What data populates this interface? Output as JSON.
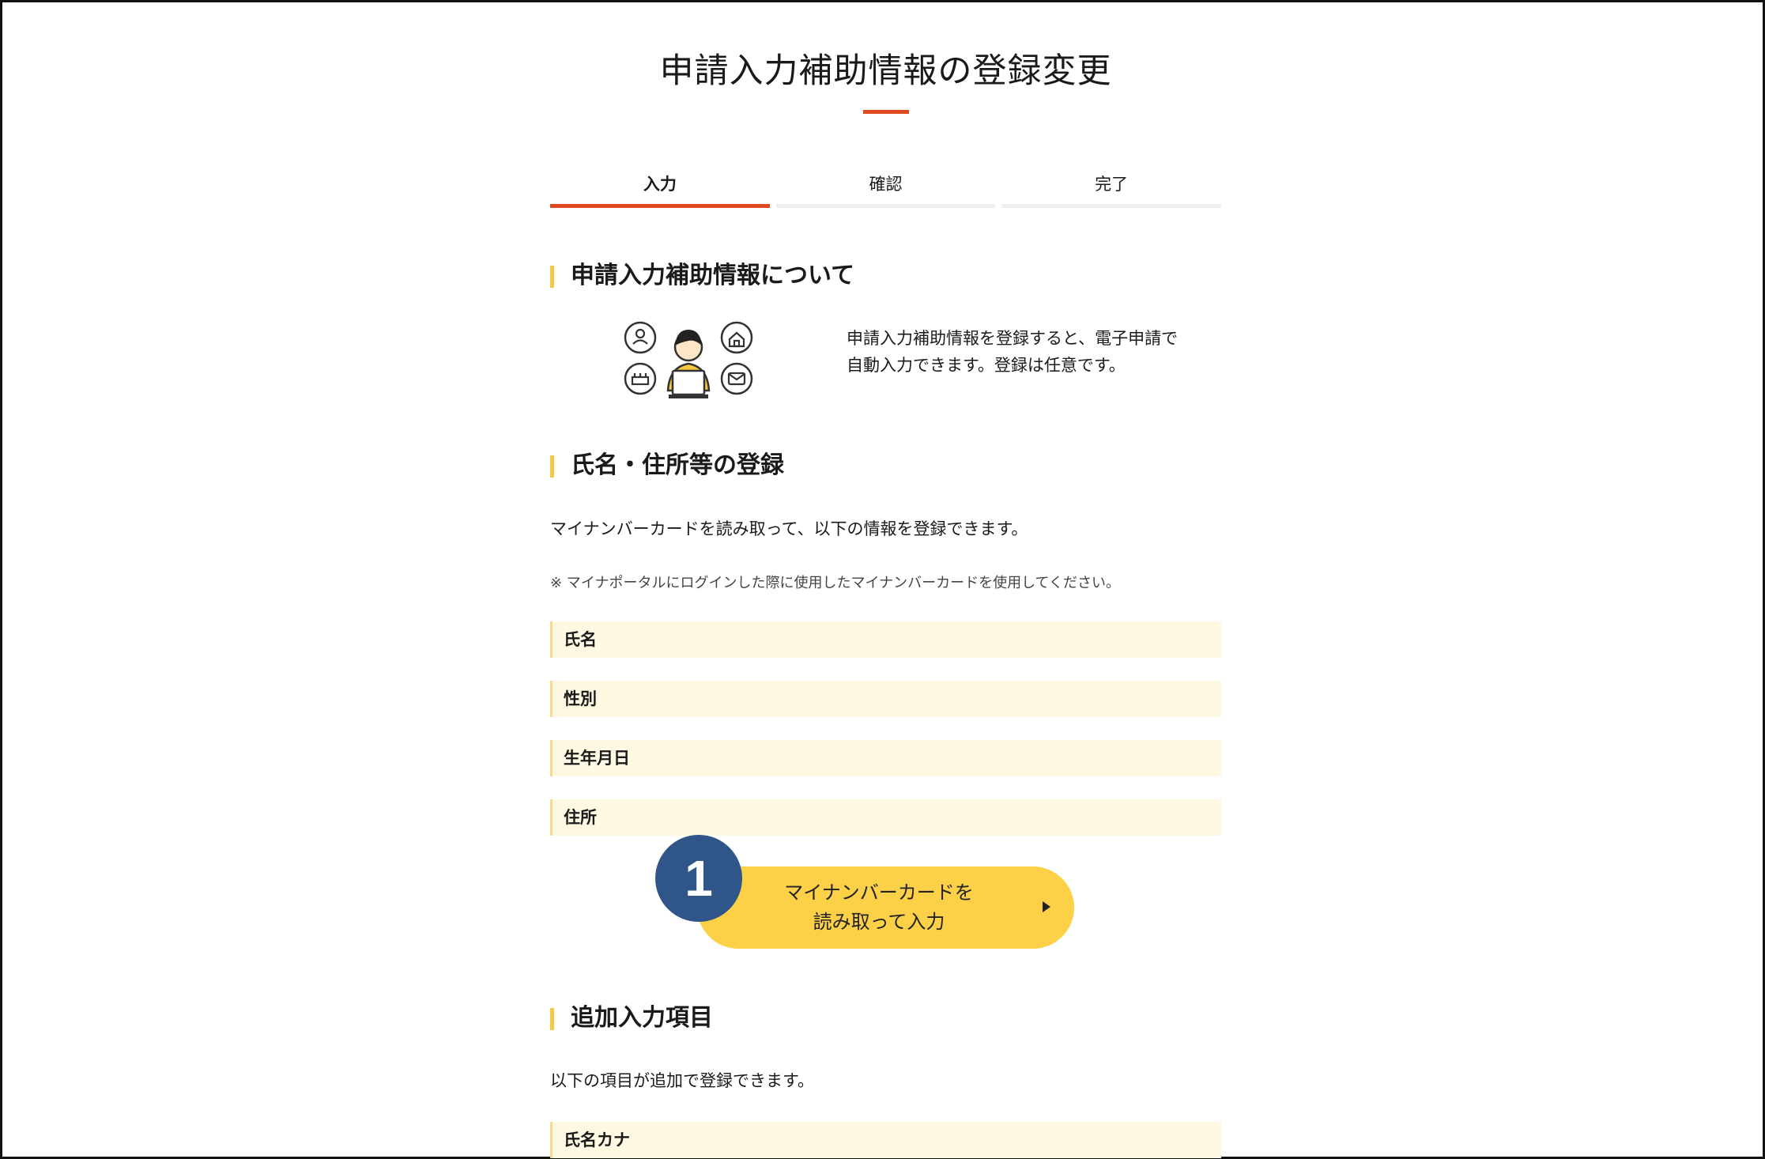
{
  "page": {
    "title": "申請入力補助情報の登録変更"
  },
  "steps": [
    {
      "label": "入力",
      "active": true
    },
    {
      "label": "確認",
      "active": false
    },
    {
      "label": "完了",
      "active": false
    }
  ],
  "about": {
    "heading": "申請入力補助情報について",
    "description_line1": "申請入力補助情報を登録すると、電子申請で",
    "description_line2": "自動入力できます。登録は任意です。",
    "illustration_icon": "person-with-laptop-icons"
  },
  "registration": {
    "heading": "氏名・住所等の登録",
    "description": "マイナンバーカードを読み取って、以下の情報を登録できます。",
    "note": "※ マイナポータルにログインした際に使用したマイナンバーカードを使用してください。",
    "fields": [
      "氏名",
      "性別",
      "生年月日",
      "住所"
    ],
    "button_line1": "マイナンバーカードを",
    "button_line2": "読み取って入力"
  },
  "callout": {
    "number": "1"
  },
  "additional": {
    "heading": "追加入力項目",
    "description": "以下の項目が追加で登録できます。",
    "fields": [
      "氏名カナ"
    ]
  },
  "colors": {
    "accent": "#e04a1f",
    "heading_bar": "#f5c842",
    "field_bg": "#fff9e3",
    "button": "#fcd148",
    "callout": "#2f5589"
  }
}
